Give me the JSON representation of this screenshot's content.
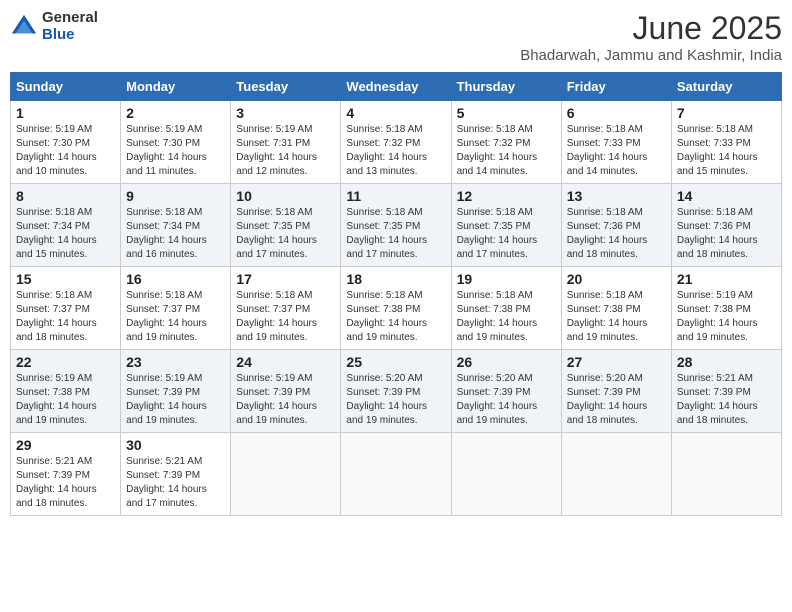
{
  "header": {
    "logo_general": "General",
    "logo_blue": "Blue",
    "month_year": "June 2025",
    "location": "Bhadarwah, Jammu and Kashmir, India"
  },
  "weekdays": [
    "Sunday",
    "Monday",
    "Tuesday",
    "Wednesday",
    "Thursday",
    "Friday",
    "Saturday"
  ],
  "weeks": [
    [
      {
        "day": "1",
        "sunrise": "Sunrise: 5:19 AM",
        "sunset": "Sunset: 7:30 PM",
        "daylight": "Daylight: 14 hours and 10 minutes."
      },
      {
        "day": "2",
        "sunrise": "Sunrise: 5:19 AM",
        "sunset": "Sunset: 7:30 PM",
        "daylight": "Daylight: 14 hours and 11 minutes."
      },
      {
        "day": "3",
        "sunrise": "Sunrise: 5:19 AM",
        "sunset": "Sunset: 7:31 PM",
        "daylight": "Daylight: 14 hours and 12 minutes."
      },
      {
        "day": "4",
        "sunrise": "Sunrise: 5:18 AM",
        "sunset": "Sunset: 7:32 PM",
        "daylight": "Daylight: 14 hours and 13 minutes."
      },
      {
        "day": "5",
        "sunrise": "Sunrise: 5:18 AM",
        "sunset": "Sunset: 7:32 PM",
        "daylight": "Daylight: 14 hours and 14 minutes."
      },
      {
        "day": "6",
        "sunrise": "Sunrise: 5:18 AM",
        "sunset": "Sunset: 7:33 PM",
        "daylight": "Daylight: 14 hours and 14 minutes."
      },
      {
        "day": "7",
        "sunrise": "Sunrise: 5:18 AM",
        "sunset": "Sunset: 7:33 PM",
        "daylight": "Daylight: 14 hours and 15 minutes."
      }
    ],
    [
      {
        "day": "8",
        "sunrise": "Sunrise: 5:18 AM",
        "sunset": "Sunset: 7:34 PM",
        "daylight": "Daylight: 14 hours and 15 minutes."
      },
      {
        "day": "9",
        "sunrise": "Sunrise: 5:18 AM",
        "sunset": "Sunset: 7:34 PM",
        "daylight": "Daylight: 14 hours and 16 minutes."
      },
      {
        "day": "10",
        "sunrise": "Sunrise: 5:18 AM",
        "sunset": "Sunset: 7:35 PM",
        "daylight": "Daylight: 14 hours and 17 minutes."
      },
      {
        "day": "11",
        "sunrise": "Sunrise: 5:18 AM",
        "sunset": "Sunset: 7:35 PM",
        "daylight": "Daylight: 14 hours and 17 minutes."
      },
      {
        "day": "12",
        "sunrise": "Sunrise: 5:18 AM",
        "sunset": "Sunset: 7:35 PM",
        "daylight": "Daylight: 14 hours and 17 minutes."
      },
      {
        "day": "13",
        "sunrise": "Sunrise: 5:18 AM",
        "sunset": "Sunset: 7:36 PM",
        "daylight": "Daylight: 14 hours and 18 minutes."
      },
      {
        "day": "14",
        "sunrise": "Sunrise: 5:18 AM",
        "sunset": "Sunset: 7:36 PM",
        "daylight": "Daylight: 14 hours and 18 minutes."
      }
    ],
    [
      {
        "day": "15",
        "sunrise": "Sunrise: 5:18 AM",
        "sunset": "Sunset: 7:37 PM",
        "daylight": "Daylight: 14 hours and 18 minutes."
      },
      {
        "day": "16",
        "sunrise": "Sunrise: 5:18 AM",
        "sunset": "Sunset: 7:37 PM",
        "daylight": "Daylight: 14 hours and 19 minutes."
      },
      {
        "day": "17",
        "sunrise": "Sunrise: 5:18 AM",
        "sunset": "Sunset: 7:37 PM",
        "daylight": "Daylight: 14 hours and 19 minutes."
      },
      {
        "day": "18",
        "sunrise": "Sunrise: 5:18 AM",
        "sunset": "Sunset: 7:38 PM",
        "daylight": "Daylight: 14 hours and 19 minutes."
      },
      {
        "day": "19",
        "sunrise": "Sunrise: 5:18 AM",
        "sunset": "Sunset: 7:38 PM",
        "daylight": "Daylight: 14 hours and 19 minutes."
      },
      {
        "day": "20",
        "sunrise": "Sunrise: 5:18 AM",
        "sunset": "Sunset: 7:38 PM",
        "daylight": "Daylight: 14 hours and 19 minutes."
      },
      {
        "day": "21",
        "sunrise": "Sunrise: 5:19 AM",
        "sunset": "Sunset: 7:38 PM",
        "daylight": "Daylight: 14 hours and 19 minutes."
      }
    ],
    [
      {
        "day": "22",
        "sunrise": "Sunrise: 5:19 AM",
        "sunset": "Sunset: 7:38 PM",
        "daylight": "Daylight: 14 hours and 19 minutes."
      },
      {
        "day": "23",
        "sunrise": "Sunrise: 5:19 AM",
        "sunset": "Sunset: 7:39 PM",
        "daylight": "Daylight: 14 hours and 19 minutes."
      },
      {
        "day": "24",
        "sunrise": "Sunrise: 5:19 AM",
        "sunset": "Sunset: 7:39 PM",
        "daylight": "Daylight: 14 hours and 19 minutes."
      },
      {
        "day": "25",
        "sunrise": "Sunrise: 5:20 AM",
        "sunset": "Sunset: 7:39 PM",
        "daylight": "Daylight: 14 hours and 19 minutes."
      },
      {
        "day": "26",
        "sunrise": "Sunrise: 5:20 AM",
        "sunset": "Sunset: 7:39 PM",
        "daylight": "Daylight: 14 hours and 19 minutes."
      },
      {
        "day": "27",
        "sunrise": "Sunrise: 5:20 AM",
        "sunset": "Sunset: 7:39 PM",
        "daylight": "Daylight: 14 hours and 18 minutes."
      },
      {
        "day": "28",
        "sunrise": "Sunrise: 5:21 AM",
        "sunset": "Sunset: 7:39 PM",
        "daylight": "Daylight: 14 hours and 18 minutes."
      }
    ],
    [
      {
        "day": "29",
        "sunrise": "Sunrise: 5:21 AM",
        "sunset": "Sunset: 7:39 PM",
        "daylight": "Daylight: 14 hours and 18 minutes."
      },
      {
        "day": "30",
        "sunrise": "Sunrise: 5:21 AM",
        "sunset": "Sunset: 7:39 PM",
        "daylight": "Daylight: 14 hours and 17 minutes."
      },
      null,
      null,
      null,
      null,
      null
    ]
  ]
}
